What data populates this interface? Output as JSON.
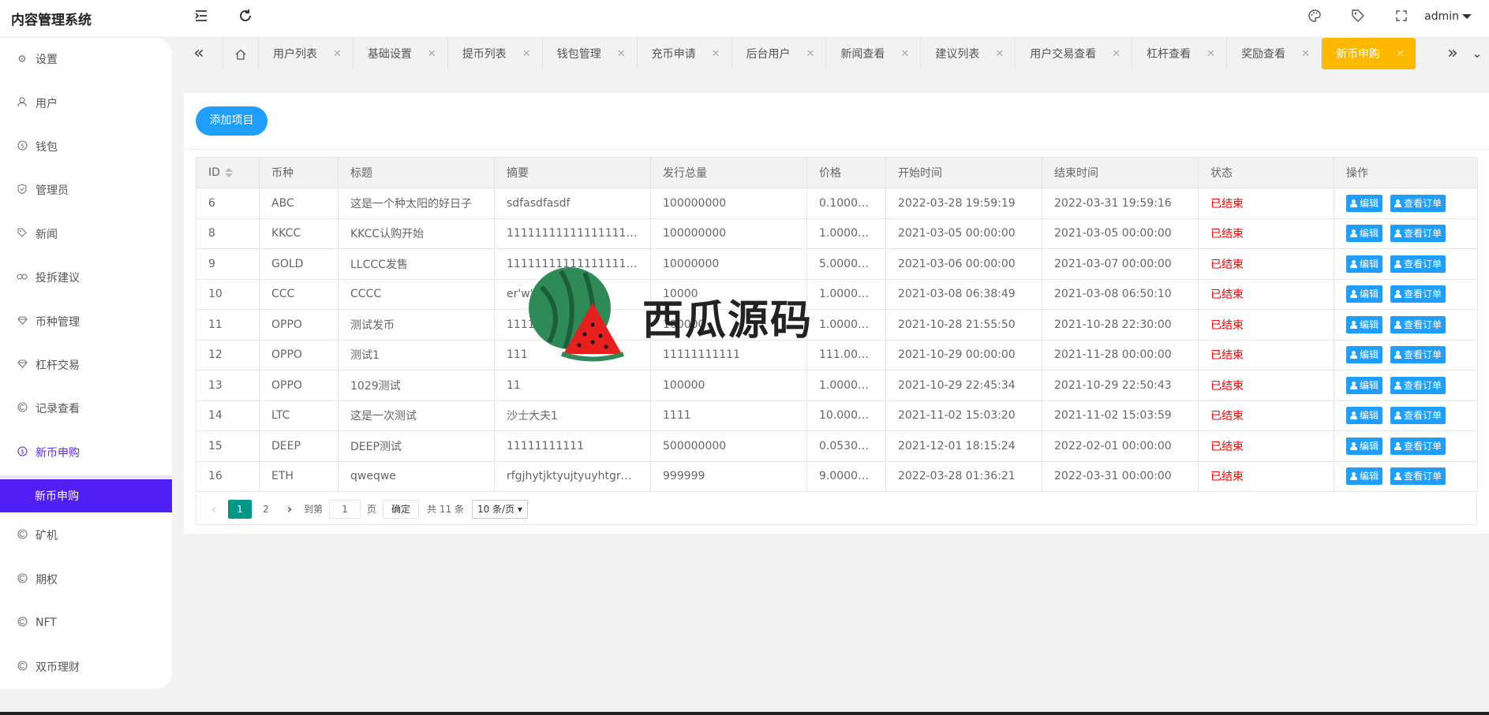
{
  "app": {
    "title": "内容管理系统",
    "user": "admin"
  },
  "sidebar": {
    "items": [
      {
        "label": "设置",
        "icon": "gear-icon"
      },
      {
        "label": "用户",
        "icon": "user-icon"
      },
      {
        "label": "钱包",
        "icon": "dollar-icon"
      },
      {
        "label": "管理员",
        "icon": "shield-icon"
      },
      {
        "label": "新闻",
        "icon": "tag-icon"
      },
      {
        "label": "投拆建议",
        "icon": "link-icon"
      },
      {
        "label": "币种管理",
        "icon": "diamond-icon"
      },
      {
        "label": "杠杆交易",
        "icon": "diamond-icon"
      },
      {
        "label": "记录查看",
        "icon": "coin-icon"
      },
      {
        "label": "新币申购",
        "icon": "dollar-icon"
      },
      {
        "label": "矿机",
        "icon": "coin-icon"
      },
      {
        "label": "期权",
        "icon": "coin-icon"
      },
      {
        "label": "NFT",
        "icon": "coin-icon"
      },
      {
        "label": "双币理财",
        "icon": "coin-icon"
      }
    ],
    "active_sub": "新币申购"
  },
  "tabs": [
    "用户列表",
    "基础设置",
    "提币列表",
    "钱包管理",
    "充币申请",
    "后台用户",
    "新闻查看",
    "建议列表",
    "用户交易查看",
    "杠杆查看",
    "奖励查看",
    "新币申购"
  ],
  "toolbar": {
    "add_label": "添加项目"
  },
  "table": {
    "headers": [
      "ID",
      "币种",
      "标题",
      "摘要",
      "发行总量",
      "价格",
      "开始时间",
      "结束时间",
      "状态",
      "操作"
    ],
    "edit_label": "编辑",
    "orders_label": "查看订单",
    "rows": [
      [
        "6",
        "ABC",
        "这是一个种太阳的好日子",
        "sdfasdfasdf",
        "100000000",
        "0.10000...",
        "2022-03-28 19:59:19",
        "2022-03-31 19:59:16",
        "已结束"
      ],
      [
        "8",
        "KKCC",
        "KKCC认购开始",
        "11111111111111111111111...",
        "100000000",
        "1.00000...",
        "2021-03-05 00:00:00",
        "2021-03-05 00:00:00",
        "已结束"
      ],
      [
        "9",
        "GOLD",
        "LLCCC发售",
        "11111111111111111111111...",
        "10000000",
        "5.00000...",
        "2021-03-06 00:00:00",
        "2021-03-07 00:00:00",
        "已结束"
      ],
      [
        "10",
        "CCC",
        "CCCC",
        "er'w'",
        "10000",
        "1.00000...",
        "2021-03-08 06:38:49",
        "2021-03-08 06:50:10",
        "已结束"
      ],
      [
        "11",
        "OPPO",
        "测试发币",
        "1111",
        "100000",
        "1.00000...",
        "2021-10-28 21:55:50",
        "2021-10-28 22:30:00",
        "已结束"
      ],
      [
        "12",
        "OPPO",
        "测试1",
        "111",
        "11111111111",
        "111.000...",
        "2021-10-29 00:00:00",
        "2021-11-28 00:00:00",
        "已结束"
      ],
      [
        "13",
        "OPPO",
        "1029测试",
        "11",
        "100000",
        "1.00000...",
        "2021-10-29 22:45:34",
        "2021-10-29 22:50:43",
        "已结束"
      ],
      [
        "14",
        "LTC",
        "这是一次测试",
        "沙士大夫1",
        "1111",
        "10.0000...",
        "2021-11-02 15:03:20",
        "2021-11-02 15:03:59",
        "已结束"
      ],
      [
        "15",
        "DEEP",
        "DEEP测试",
        "11111111111",
        "500000000",
        "0.05300...",
        "2021-12-01 18:15:24",
        "2022-02-01 00:00:00",
        "已结束"
      ],
      [
        "16",
        "ETH",
        "qweqwe",
        "rfgjhytjktyujtyuyhtgrdujhr...",
        "999999",
        "9.00000...",
        "2022-03-28 01:36:21",
        "2022-03-31 00:00:00",
        "已结束"
      ]
    ]
  },
  "pager": {
    "current": "1",
    "next_page": "2",
    "goto_label": "到第",
    "goto_value": "1",
    "page_label": "页",
    "confirm_label": "确定",
    "total_label": "共 11 条",
    "page_size": "10 条/页"
  },
  "watermark": {
    "text": "西瓜源码"
  },
  "colors": {
    "accent": "#1e9fff",
    "active_tab": "#ffb800",
    "sidebar_active": "#4f1ff4",
    "status_ended": "#ff0000",
    "pager_current": "#009688"
  }
}
